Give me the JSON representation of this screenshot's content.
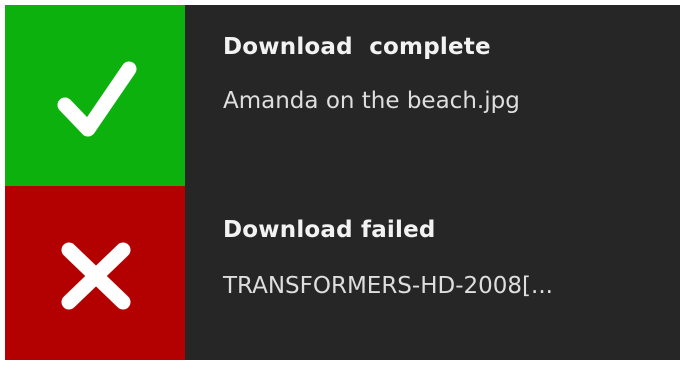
{
  "notifications": [
    {
      "status": "success",
      "title": "Download  complete",
      "detail": "Amanda on the beach.jpg",
      "icon": "checkmark-icon",
      "color": "#0db10d"
    },
    {
      "status": "failed",
      "title": "Download failed",
      "detail": "TRANSFORMERS-HD-2008[...",
      "icon": "x-icon",
      "color": "#b30000"
    }
  ],
  "colors": {
    "background": "#262626",
    "text": "#f2f2f2"
  }
}
